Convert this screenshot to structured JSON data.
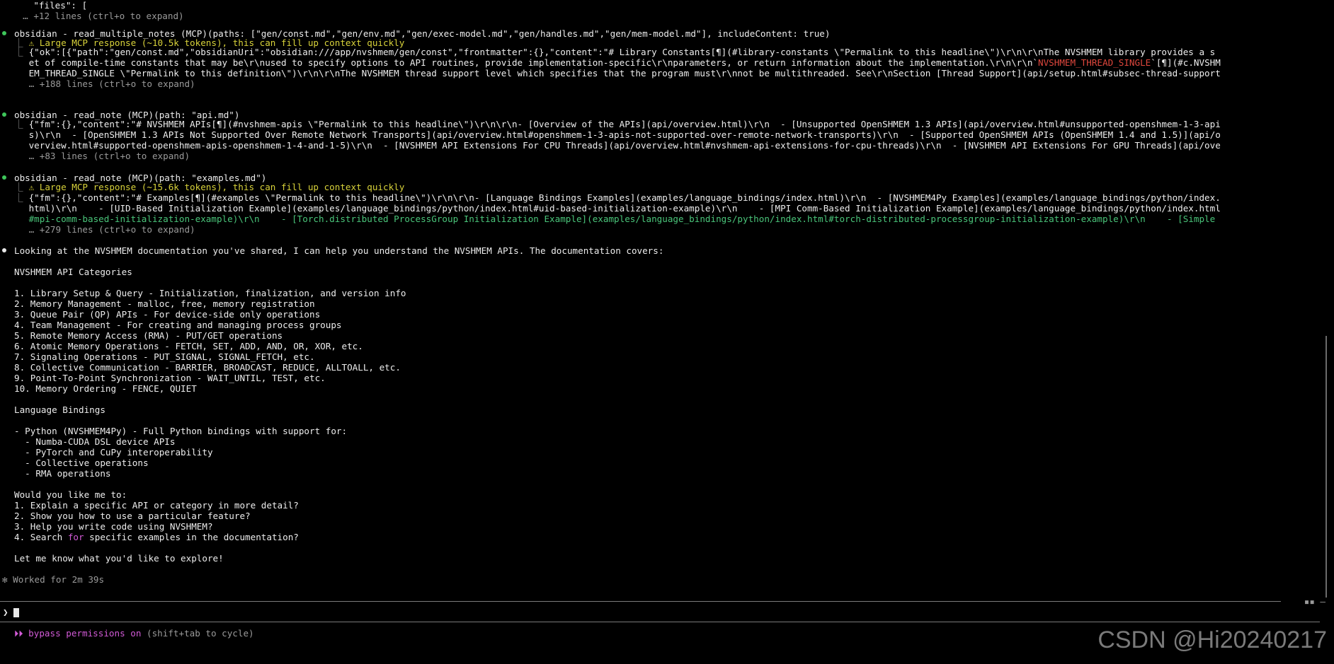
{
  "transcript": {
    "files_line": "    \"files\": [",
    "expand_1": "  … +12 lines (ctrl+o to expand)",
    "call_1": {
      "header": "obsidian - read_multiple_notes (MCP)(paths: [\"gen/const.md\",\"gen/env.md\",\"gen/exec-model.md\",\"gen/handles.md\",\"gen/mem-model.md\"], includeContent: true)",
      "warning": " ⚠ Large MCP response (~10.5k tokens), this can fill up context quickly",
      "out1a": " {\"ok\":[{\"path\":\"gen/const.md\",\"obsidianUri\":\"obsidian:///app/nvshmem/gen/const\",\"frontmatter\":{},\"content\":\"# Library Constants[¶](#library-constants \\\"Permalink to this headline\\\")\\r\\n\\r\\nThe NVSHMEM library provides a s",
      "out2a": " et of compile-time constants that may be\\r\\nused to specify options to API routines, provide implementation-specific\\r\\nparameters, or return information about the implementation.\\r\\n\\r\\n`",
      "out2red": "NVSHMEM_THREAD_SINGLE",
      "out2b": "`[¶](#c.NVSHM",
      "out3": " EM_THREAD_SINGLE \\\"Permalink to this definition\\\")\\r\\n\\r\\nThe NVSHMEM thread support level which specifies that the program must\\r\\nnot be multithreaded. See\\r\\nSection [Thread Support](api/setup.html#subsec-thread-support",
      "expand": " … +188 lines (ctrl+o to expand)"
    },
    "call_2": {
      "header": "obsidian - read_note (MCP)(path: \"api.md\")",
      "out1": " {\"fm\":{},\"content\":\"# NVSHMEM APIs[¶](#nvshmem-apis \\\"Permalink to this headline\\\")\\r\\n\\r\\n- [Overview of the APIs](api/overview.html)\\r\\n  - [Unsupported OpenSHMEM 1.3 APIs](api/overview.html#unsupported-openshmem-1-3-api",
      "out2": " s)\\r\\n  - [OpenSHMEM 1.3 APIs Not Supported Over Remote Network Transports](api/overview.html#openshmem-1-3-apis-not-supported-over-remote-network-transports)\\r\\n  - [Supported OpenSHMEM APIs (OpenSHMEM 1.4 and 1.5)](api/o",
      "out3": " verview.html#supported-openshmem-apis-openshmem-1-4-and-1-5)\\r\\n  - [NVSHMEM API Extensions For CPU Threads](api/overview.html#nvshmem-api-extensions-for-cpu-threads)\\r\\n  - [NVSHMEM API Extensions For GPU Threads](api/ove",
      "expand": " … +83 lines (ctrl+o to expand)"
    },
    "call_3": {
      "header": "obsidian - read_note (MCP)(path: \"examples.md\")",
      "warning": " ⚠ Large MCP response (~15.6k tokens), this can fill up context quickly",
      "out1": " {\"fm\":{},\"content\":\"# Examples[¶](#examples \\\"Permalink to this headline\\\")\\r\\n\\r\\n- [Language Bindings Examples](examples/language_bindings/index.html)\\r\\n  - [NVSHMEM4Py Examples](examples/language_bindings/python/index.",
      "out2": " html)\\r\\n    - [UID-Based Initialization Example](examples/language_bindings/python/index.html#uid-based-initialization-example)\\r\\n    - [MPI Comm-Based Initialization Example](examples/language_bindings/python/index.html",
      "out3": " #mpi-comm-based-initialization-example)\\r\\n    - [Torch.distributed ProcessGroup Initialization Example](examples/language_bindings/python/index.html#torch-distributed-processgroup-initialization-example)\\r\\n    - [Simple",
      "expand": " … +279 lines (ctrl+o to expand)"
    },
    "reply": {
      "intro": "Looking at the NVSHMEM documentation you've shared, I can help you understand the NVSHMEM APIs. The documentation covers:",
      "categories_title": "NVSHMEM API Categories",
      "categories": [
        "1. Library Setup & Query - Initialization, finalization, and version info",
        "2. Memory Management - malloc, free, memory registration",
        "3. Queue Pair (QP) APIs - For device-side only operations",
        "4. Team Management - For creating and managing process groups",
        "5. Remote Memory Access (RMA) - PUT/GET operations",
        "6. Atomic Memory Operations - FETCH, SET, ADD, AND, OR, XOR, etc.",
        "7. Signaling Operations - PUT_SIGNAL, SIGNAL_FETCH, etc.",
        "8. Collective Communication - BARRIER, BROADCAST, REDUCE, ALLTOALL, etc.",
        "9. Point-To-Point Synchronization - WAIT_UNTIL, TEST, etc.",
        "10. Memory Ordering - FENCE, QUIET"
      ],
      "bindings_title": "Language Bindings",
      "bindings": [
        "- Python (NVSHMEM4Py) - Full Python bindings with support for:",
        "  - Numba-CUDA DSL device APIs",
        "  - PyTorch and CuPy interoperability",
        "  - Collective operations",
        "  - RMA operations"
      ],
      "question": "Would you like me to:",
      "options": [
        "1. Explain a specific API or category in more detail?",
        "2. Show you how to use a particular feature?",
        "3. Help you write code using NVSHMEM?"
      ],
      "option4_pre": "4. Search ",
      "option4_kw": "for",
      "option4_post": " specific examples in the documentation?",
      "closing": "Let me know what you'd like to explore!"
    },
    "worked": "✻ Worked for 2m 39s"
  },
  "prompt": {
    "symbol": "❯",
    "right_icon": "▪▪ –"
  },
  "status": {
    "icon": "⏵⏵",
    "mode": " bypass permissions on",
    "hint": " (shift+tab to cycle)"
  },
  "watermark": "CSDN @Hi20240217"
}
